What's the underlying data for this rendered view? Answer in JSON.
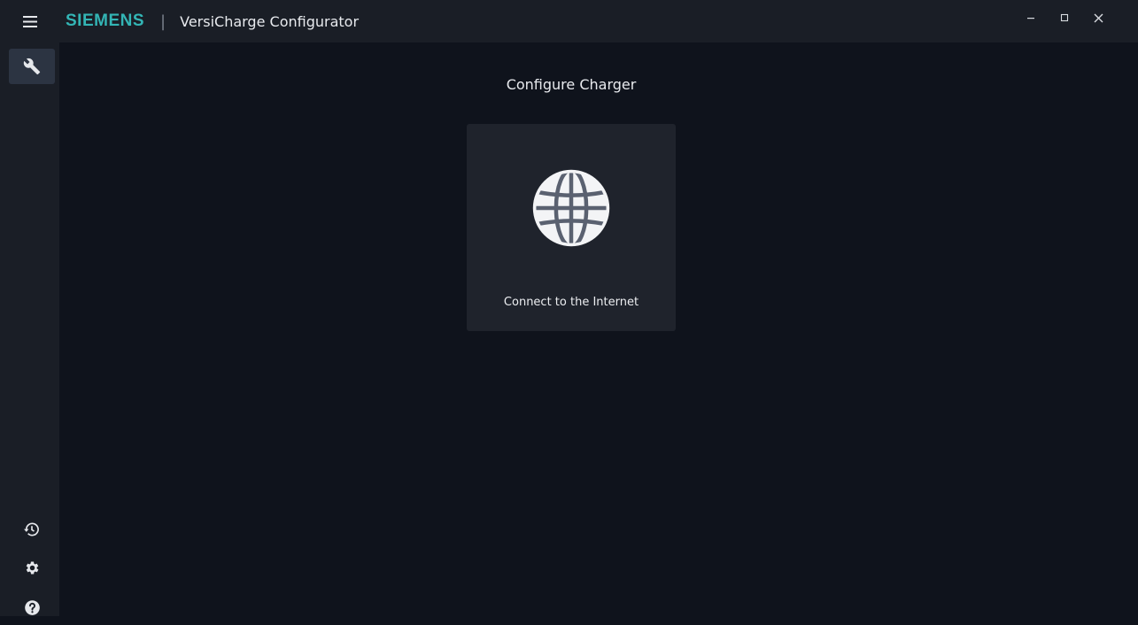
{
  "titlebar": {
    "brand": "SIEMENS",
    "separator": "|",
    "app_title": "VersiCharge Configurator",
    "menu_icon": "hamburger-menu-icon",
    "window_controls": [
      "minimize-icon",
      "maximize-icon",
      "close-icon"
    ]
  },
  "sidebar": {
    "top_items": [
      {
        "icon": "wrench-icon",
        "active": true
      }
    ],
    "bottom_items": [
      {
        "icon": "history-icon"
      },
      {
        "icon": "gear-icon"
      },
      {
        "icon": "help-icon"
      }
    ]
  },
  "main": {
    "heading": "Configure Charger",
    "cards": [
      {
        "icon": "globe-icon",
        "label": "Connect to the Internet"
      }
    ]
  },
  "colors": {
    "brand": "#33b5b5",
    "titlebar_bg": "#1a1e26",
    "main_bg": "#0f131c",
    "card_bg": "#1f232c",
    "active_item_bg": "#2c3442"
  }
}
